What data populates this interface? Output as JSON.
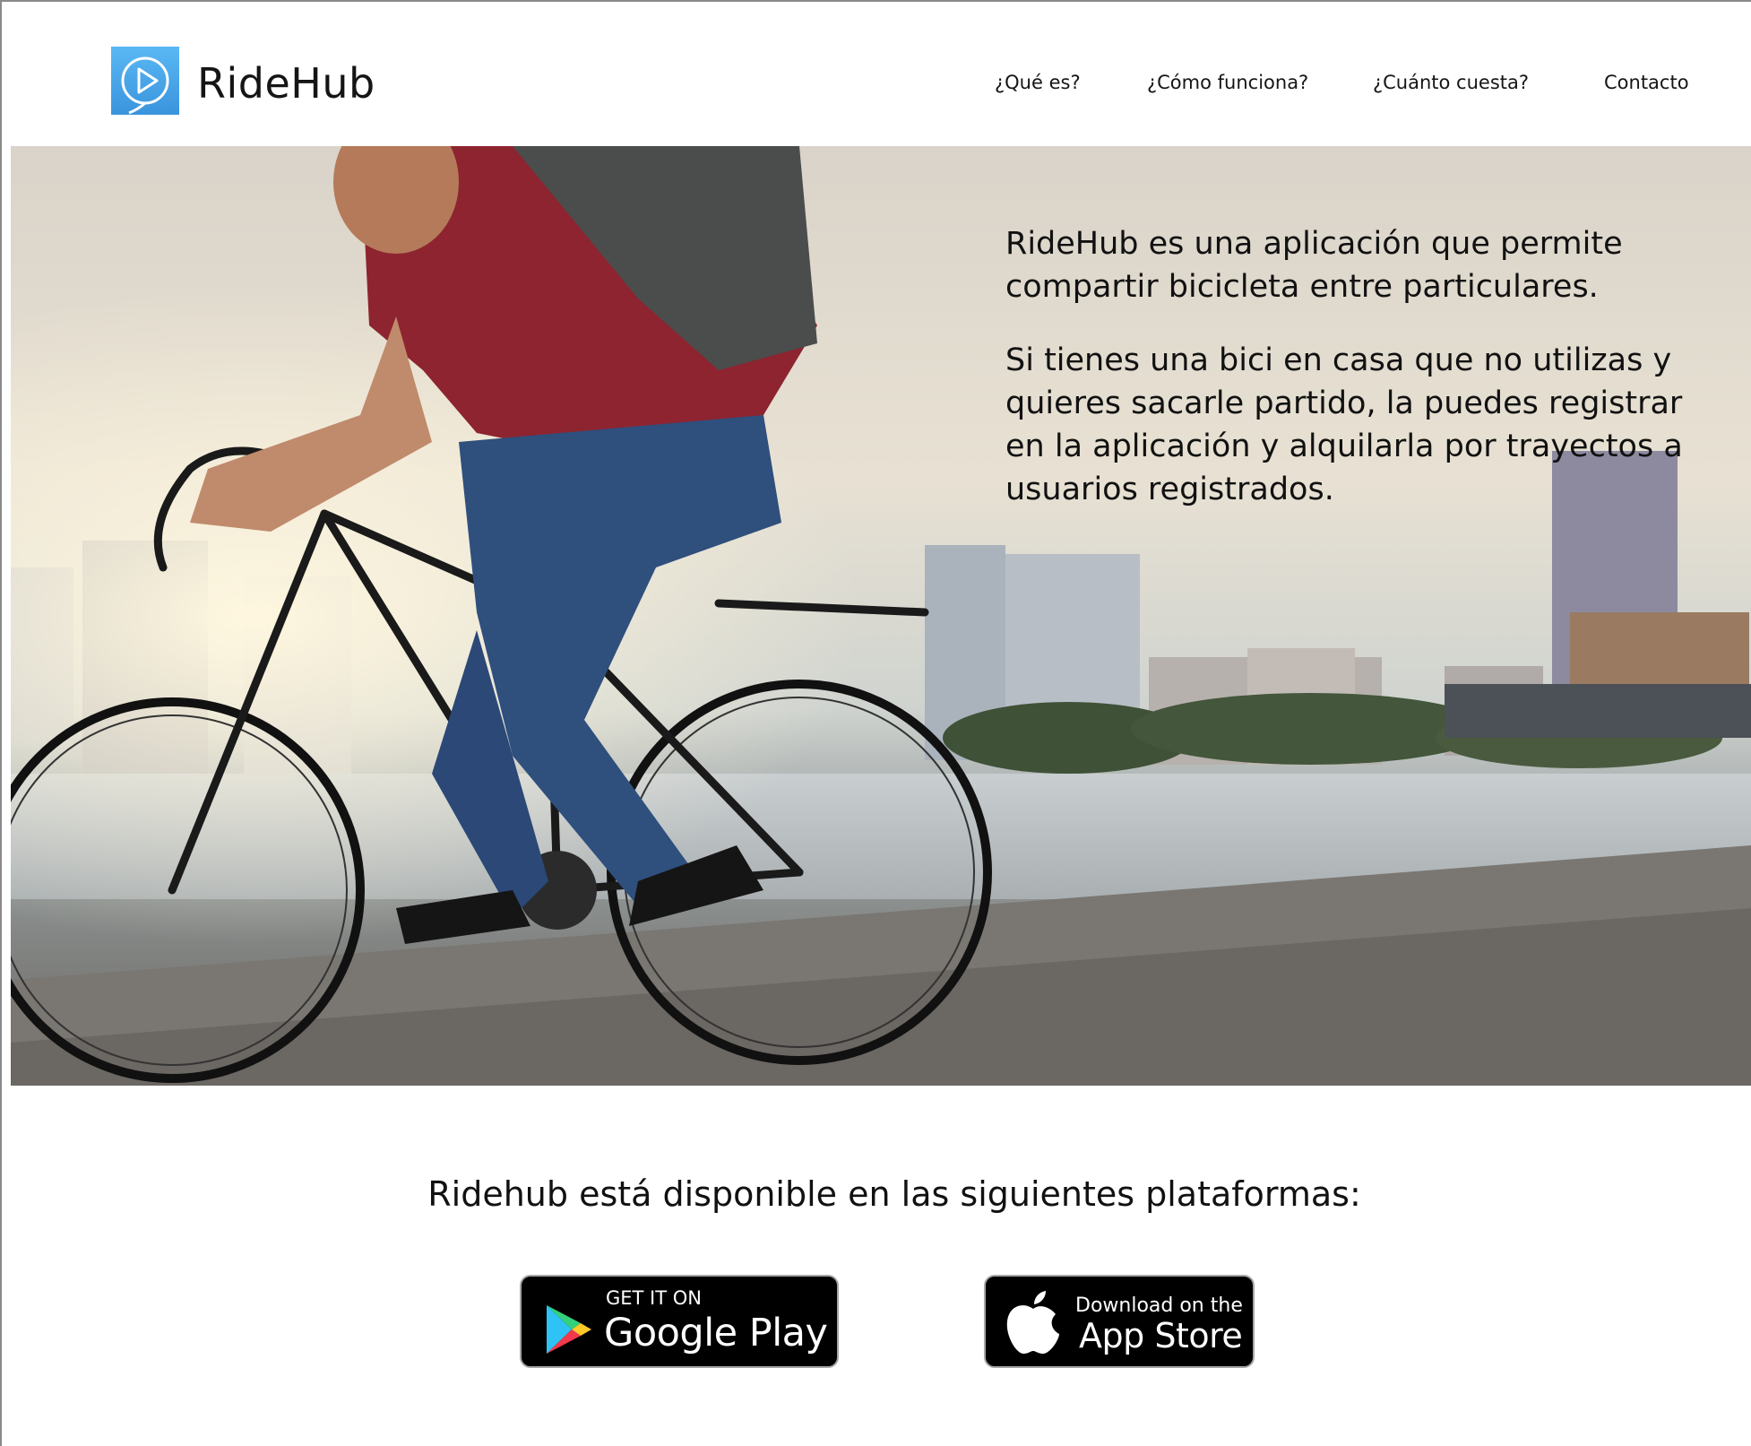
{
  "brand": {
    "name": "RideHub",
    "accent": "#4aa8ea"
  },
  "nav": {
    "items": [
      {
        "label": "¿Qué es?"
      },
      {
        "label": "¿Cómo funciona?"
      },
      {
        "label": "¿Cuánto cuesta?"
      },
      {
        "label": "Contacto"
      }
    ]
  },
  "hero": {
    "paragraph_1": "RideHub es una aplicación que permite compartir bicicleta entre particulares.",
    "paragraph_2": "Si tienes una bici en casa que no utilizas y quieres sacarle partido, la puedes registrar en la aplicación y alquilarla por trayectos a usuarios registrados."
  },
  "platforms": {
    "title": "Ridehub está disponible en las siguientes plataformas:",
    "google_play": {
      "small": "GET IT ON",
      "big": "Google Play"
    },
    "app_store": {
      "small": "Download on the",
      "big": "App Store"
    }
  }
}
